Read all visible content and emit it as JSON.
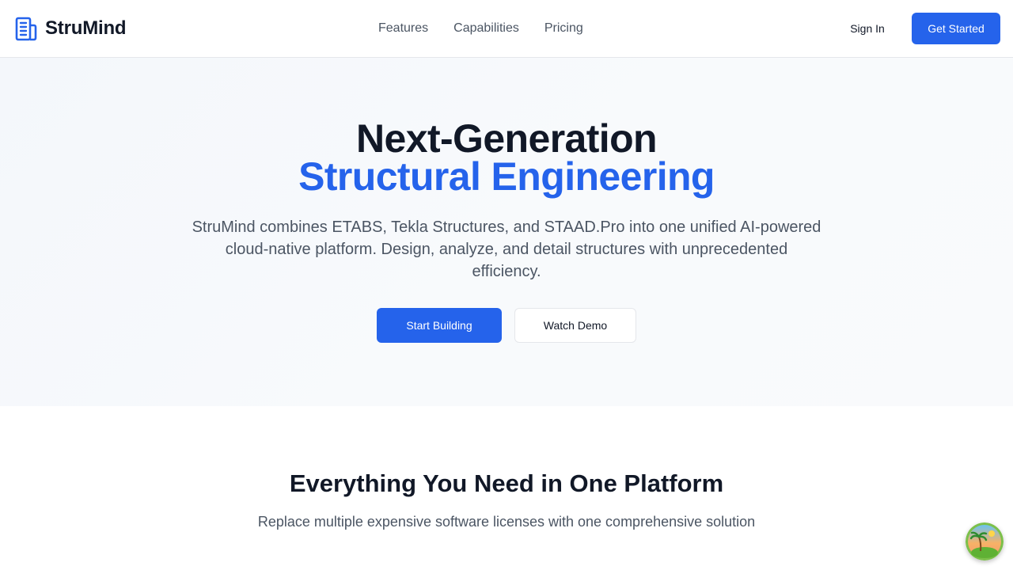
{
  "brand": {
    "name": "StruMind",
    "icon": "building-icon"
  },
  "nav": {
    "links": [
      "Features",
      "Capabilities",
      "Pricing"
    ],
    "sign_in": "Sign In",
    "get_started": "Get Started"
  },
  "hero": {
    "title_line1": "Next-Generation",
    "title_line2": "Structural Engineering",
    "subtitle": "StruMind combines ETABS, Tekla Structures, and STAAD.Pro into one unified AI-powered cloud-native platform. Design, analyze, and detail structures with unprecedented efficiency.",
    "primary_button": "Start Building",
    "secondary_button": "Watch Demo"
  },
  "features": {
    "title": "Everything You Need in One Platform",
    "subtitle": "Replace multiple expensive software licenses with one comprehensive solution"
  },
  "floating_widget": {
    "icon": "island-palm-icon"
  },
  "colors": {
    "accent": "#2563eb",
    "text_dark": "#111827",
    "text_muted": "#4b5563",
    "border": "#e5e7eb",
    "hero_bg": "#f5f8fb"
  }
}
